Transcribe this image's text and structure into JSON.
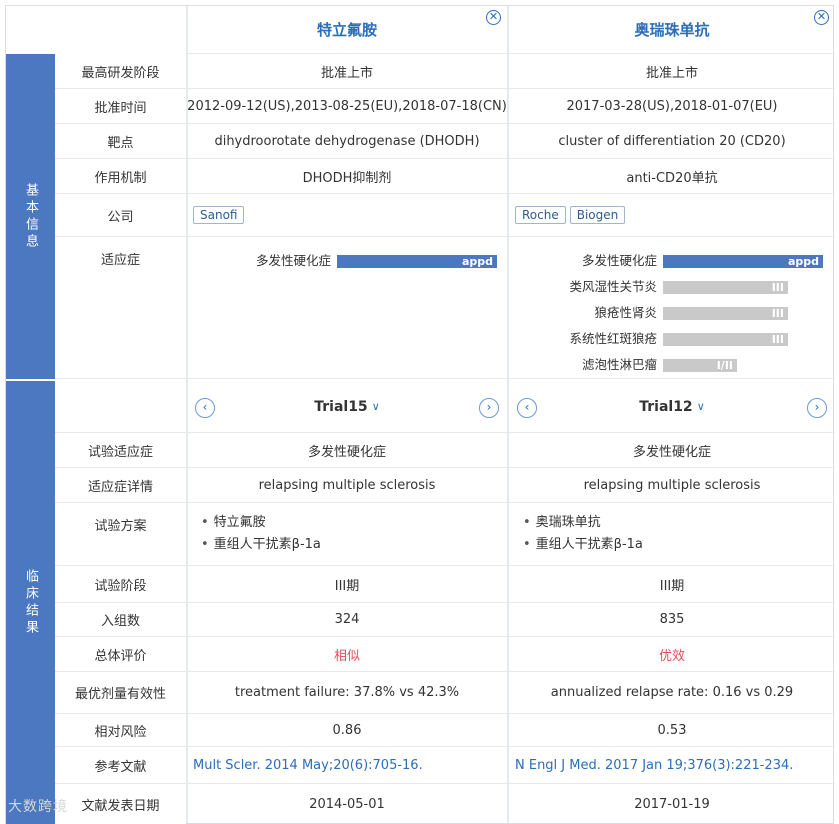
{
  "sections": {
    "basic": "基本信息",
    "clinical": "临床结果"
  },
  "labels": {
    "stage": "最高研发阶段",
    "approval": "批准时间",
    "target": "靶点",
    "mechanism": "作用机制",
    "company": "公司",
    "indication": "适应症",
    "trial_indication": "试验适应症",
    "indication_detail": "适应症详情",
    "scheme": "试验方案",
    "phase": "试验阶段",
    "enrollment": "入组数",
    "evaluation": "总体评价",
    "efficacy": "最优剂量有效性",
    "relative_risk": "相对风险",
    "reference": "参考文献",
    "pub_date": "文献发表日期"
  },
  "drugs": [
    {
      "name": "特立氟胺",
      "stage": "批准上市",
      "approval": "2012-09-12(US),2013-08-25(EU),2018-07-18(CN)",
      "target": "dihydroorotate dehydrogenase (DHODH)",
      "mechanism": "DHODH抑制剂",
      "companies": [
        "Sanofi"
      ],
      "indications": [
        {
          "name": "多发性硬化症",
          "phase": "appd",
          "level": 1.0,
          "color": "#4b78c0"
        }
      ],
      "trial": {
        "title": "Trial15",
        "indication": "多发性硬化症",
        "detail": "relapsing multiple sclerosis",
        "scheme": [
          "特立氟胺",
          "重组人干扰素β-1a"
        ],
        "phase": "III期",
        "enrollment": "324",
        "evaluation": "相似",
        "efficacy": "treatment failure: 37.8% vs 42.3%",
        "relative_risk": "0.86",
        "reference": "Mult Scler. 2014 May;20(6):705-16.",
        "pub_date": "2014-05-01"
      }
    },
    {
      "name": "奥瑞珠单抗",
      "stage": "批准上市",
      "approval": "2017-03-28(US),2018-01-07(EU)",
      "target": "cluster of differentiation 20 (CD20)",
      "mechanism": "anti-CD20单抗",
      "companies": [
        "Roche",
        "Biogen"
      ],
      "indications": [
        {
          "name": "多发性硬化症",
          "phase": "appd",
          "level": 1.0,
          "color": "#4b78c0"
        },
        {
          "name": "类风湿性关节炎",
          "phase": "III",
          "level": 0.78,
          "color": "#c9c9c9"
        },
        {
          "name": "狼疮性肾炎",
          "phase": "III",
          "level": 0.78,
          "color": "#c9c9c9"
        },
        {
          "name": "系统性红斑狼疮",
          "phase": "III",
          "level": 0.78,
          "color": "#c9c9c9"
        },
        {
          "name": "滤泡性淋巴瘤",
          "phase": "I/II",
          "level": 0.46,
          "color": "#c9c9c9"
        }
      ],
      "trial": {
        "title": "Trial12",
        "indication": "多发性硬化症",
        "detail": "relapsing multiple sclerosis",
        "scheme": [
          "奥瑞珠单抗",
          "重组人干扰素β-1a"
        ],
        "phase": "III期",
        "enrollment": "835",
        "evaluation": "优效",
        "efficacy": "annualized relapse rate: 0.16 vs 0.29",
        "relative_risk": "0.53",
        "reference": "N Engl J Med. 2017 Jan 19;376(3):221-234.",
        "pub_date": "2017-01-19"
      }
    }
  ],
  "watermark": "大数跨境",
  "icons": {
    "close": "close-circle-icon",
    "prev": "chevron-left-circle-icon",
    "next": "chevron-right-circle-icon",
    "dropdown": "chevron-down-icon"
  }
}
